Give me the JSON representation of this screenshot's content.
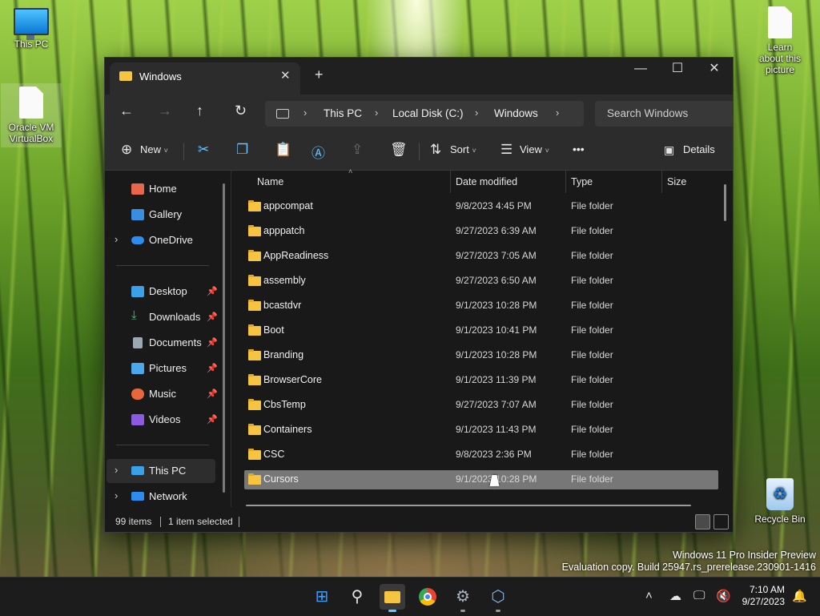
{
  "desktop": {
    "icons": [
      {
        "label": "This PC"
      },
      {
        "label": "Oracle VM VirtualBox"
      },
      {
        "label": "Learn about this picture"
      },
      {
        "label": "Recycle Bin"
      }
    ],
    "watermark": {
      "line1": "Windows 11 Pro Insider Preview",
      "line2": "Evaluation copy. Build 25947.rs_prerelease.230901-1416"
    }
  },
  "explorer": {
    "tab_title": "Windows",
    "tab_close": "✕",
    "new_tab": "+",
    "window_controls": {
      "minimize": "—",
      "maximize": "☐",
      "close": "✕"
    },
    "nav": {
      "back": "←",
      "forward": "→",
      "up": "↑",
      "refresh": "↻"
    },
    "breadcrumb": [
      "This PC",
      "Local Disk (C:)",
      "Windows"
    ],
    "search_placeholder": "Search Windows",
    "commands": {
      "new": "New",
      "sort": "Sort",
      "view": "View",
      "more": "•••",
      "details": "Details"
    },
    "sidebar": {
      "home": "Home",
      "gallery": "Gallery",
      "onedrive": "OneDrive",
      "quick_access": [
        {
          "label": "Desktop",
          "color": "#3aa0e8"
        },
        {
          "label": "Downloads",
          "color": "#3ec47a"
        },
        {
          "label": "Documents",
          "color": "#9aa7b5"
        },
        {
          "label": "Pictures",
          "color": "#4aa8ec"
        },
        {
          "label": "Music",
          "color": "#e8673a"
        },
        {
          "label": "Videos",
          "color": "#8c5ae0"
        }
      ],
      "this_pc": "This PC",
      "network": "Network"
    },
    "columns": {
      "name": "Name",
      "date": "Date modified",
      "type": "Type",
      "size": "Size"
    },
    "files": [
      {
        "name": "appcompat",
        "date": "9/8/2023 4:45 PM",
        "type": "File folder"
      },
      {
        "name": "apppatch",
        "date": "9/27/2023 6:39 AM",
        "type": "File folder"
      },
      {
        "name": "AppReadiness",
        "date": "9/27/2023 7:05 AM",
        "type": "File folder"
      },
      {
        "name": "assembly",
        "date": "9/27/2023 6:50 AM",
        "type": "File folder"
      },
      {
        "name": "bcastdvr",
        "date": "9/1/2023 10:28 PM",
        "type": "File folder"
      },
      {
        "name": "Boot",
        "date": "9/1/2023 10:41 PM",
        "type": "File folder"
      },
      {
        "name": "Branding",
        "date": "9/1/2023 10:28 PM",
        "type": "File folder"
      },
      {
        "name": "BrowserCore",
        "date": "9/1/2023 11:39 PM",
        "type": "File folder"
      },
      {
        "name": "CbsTemp",
        "date": "9/27/2023 7:07 AM",
        "type": "File folder"
      },
      {
        "name": "Containers",
        "date": "9/1/2023 11:43 PM",
        "type": "File folder"
      },
      {
        "name": "CSC",
        "date": "9/8/2023 2:36 PM",
        "type": "File folder"
      },
      {
        "name": "Cursors",
        "date": "9/1/2023 10:28 PM",
        "type": "File folder",
        "selected": true
      }
    ],
    "status": {
      "items": "99 items",
      "selected": "1 item selected"
    }
  },
  "taskbar": {
    "clock_time": "7:10 AM",
    "clock_date": "9/27/2023",
    "accent": "#60cdff"
  }
}
